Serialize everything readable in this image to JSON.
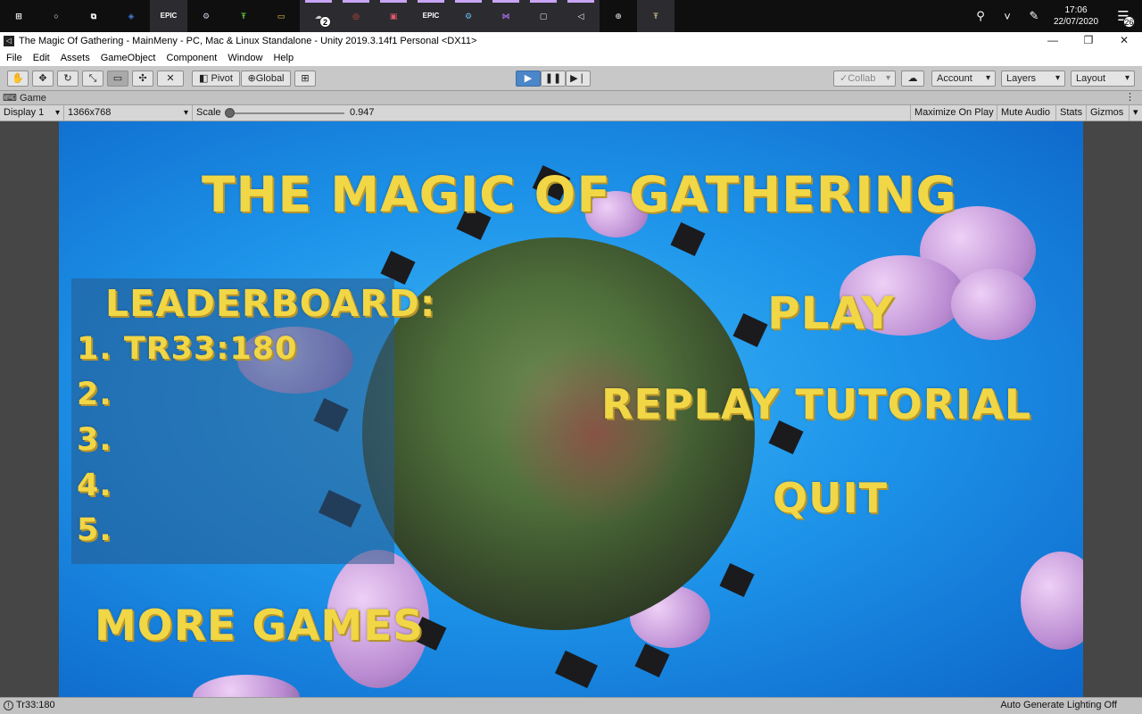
{
  "taskbar": {
    "icons": [
      {
        "name": "start-icon",
        "glyph": "⊞"
      },
      {
        "name": "cortana-icon",
        "glyph": "○"
      },
      {
        "name": "task-view-icon",
        "glyph": "⧉"
      },
      {
        "name": "unity-hub-icon",
        "glyph": "◈"
      },
      {
        "name": "epic-games-icon",
        "glyph": "EPIC"
      },
      {
        "name": "steam-icon",
        "glyph": "⚙"
      },
      {
        "name": "app-green-icon",
        "glyph": "Ŧ"
      },
      {
        "name": "file-explorer-icon",
        "glyph": "▭"
      },
      {
        "name": "app-cloud-icon",
        "glyph": "☁",
        "badge": "2"
      },
      {
        "name": "chrome-icon",
        "glyph": "◎"
      },
      {
        "name": "app-red-icon",
        "glyph": "▣"
      },
      {
        "name": "epic-games-2-icon",
        "glyph": "EPIC"
      },
      {
        "name": "steam-2-icon",
        "glyph": "⚙"
      },
      {
        "name": "visual-studio-icon",
        "glyph": "⋈"
      },
      {
        "name": "app-window-icon",
        "glyph": "▢"
      },
      {
        "name": "unity-icon",
        "glyph": "◁"
      },
      {
        "name": "app-circle-icon",
        "glyph": "⊕"
      },
      {
        "name": "app-tan-icon",
        "glyph": "Ŧ"
      }
    ],
    "clock_time": "17:06",
    "clock_date": "22/07/2020",
    "notification_count": "26"
  },
  "window": {
    "title": "The Magic Of Gathering - MainMeny - PC, Mac & Linux Standalone - Unity 2019.3.14f1 Personal <DX11>"
  },
  "menu": [
    "File",
    "Edit",
    "Assets",
    "GameObject",
    "Component",
    "Window",
    "Help"
  ],
  "toolbar": {
    "pivot": "Pivot",
    "global": "Global",
    "collab": "Collab",
    "account": "Account",
    "layers": "Layers",
    "layout": "Layout"
  },
  "game_panel": {
    "tab": "Game",
    "display": "Display 1",
    "resolution": "1366x768",
    "scale_label": "Scale",
    "scale_value": "0.947 ",
    "maximize": "Maximize On Play",
    "mute": "Mute Audio",
    "stats": "Stats",
    "gizmos": "Gizmos"
  },
  "game": {
    "title": "THE MAGIC OF GATHERING",
    "leaderboard_title": "LEADERBOARD:",
    "leaderboard": [
      "1. TR33:180",
      "2.",
      "3.",
      "4.",
      "5."
    ],
    "play": "PLAY",
    "replay_tutorial": "REPLAY TUTORIAL",
    "quit": "QUIT",
    "more_games": "MORE GAMES"
  },
  "status": {
    "message": "Tr33:180",
    "lighting": "Auto Generate Lighting Off"
  }
}
